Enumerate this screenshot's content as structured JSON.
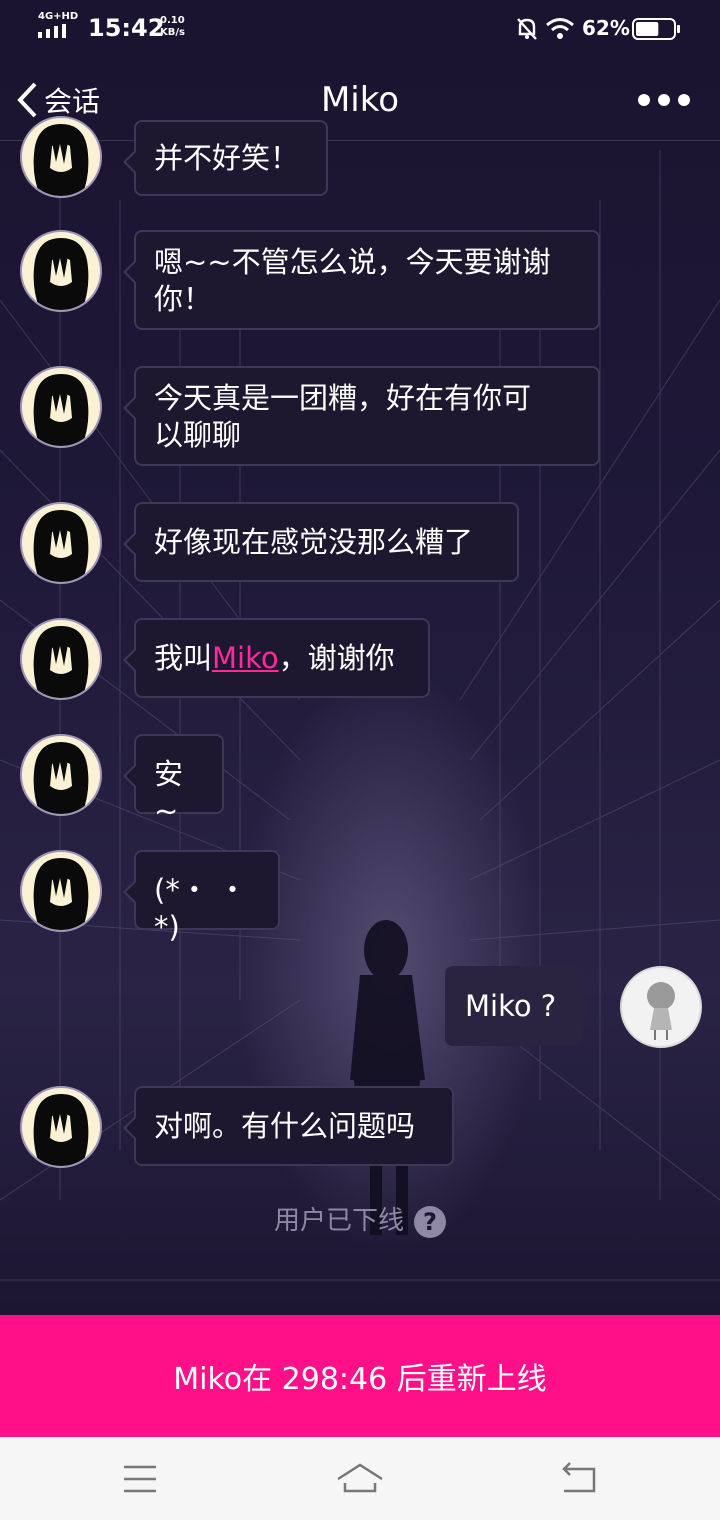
{
  "status_bar": {
    "network": "4G+HD",
    "time": "15:42",
    "speed_value": "0.10",
    "speed_unit": "KB/s",
    "battery_pct": "62%",
    "battery_level": 0.62,
    "icons": [
      "signal-icon",
      "mute-bell-icon",
      "wifi-icon",
      "battery-icon"
    ]
  },
  "header": {
    "back_label": "会话",
    "title": "Miko",
    "more_icon": "more-dots-icon"
  },
  "messages": [
    {
      "side": "left",
      "text": "并不好笑！"
    },
    {
      "side": "left",
      "lines": [
        "嗯~~不管怎么说，今天要谢谢",
        "你！"
      ]
    },
    {
      "side": "left",
      "lines": [
        "今天真是一团糟，好在有你可",
        "以聊聊"
      ]
    },
    {
      "side": "left",
      "text": "好像现在感觉没那么糟了"
    },
    {
      "side": "left",
      "before": "我叫",
      "link": "Miko",
      "after": "，谢谢你"
    },
    {
      "side": "left",
      "text": "安~"
    },
    {
      "side": "left",
      "text": "(*・ ・*)"
    },
    {
      "side": "right",
      "text": "Miko ?"
    },
    {
      "side": "left",
      "text": "对啊。有什么问题吗"
    }
  ],
  "offline_status": "用户已下线",
  "banner": "Miko在 298:46 后重新上线",
  "nav": {
    "icons": [
      "menu-icon",
      "home-icon",
      "back-icon"
    ]
  },
  "colors": {
    "accent": "#ff0f88",
    "link": "#ff2a9a",
    "bubble": "#1d1730"
  }
}
